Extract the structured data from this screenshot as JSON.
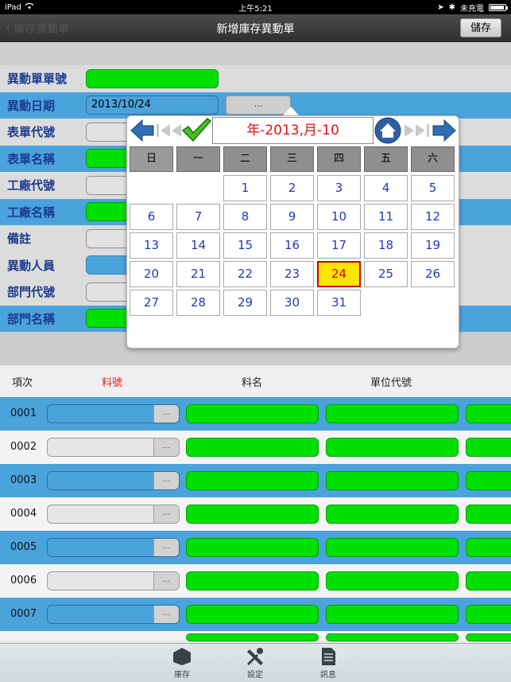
{
  "status": {
    "device": "iPad",
    "time": "上午5:21",
    "charge": "未充電"
  },
  "nav": {
    "back_label": "庫存異動單",
    "title": "新增庫存異動單",
    "save_label": "儲存"
  },
  "form": {
    "rows": [
      {
        "label": "異動單單號",
        "value": ""
      },
      {
        "label": "異動日期",
        "value": "2013/10/24",
        "button": "..."
      },
      {
        "label": "表單代號",
        "value": ""
      },
      {
        "label": "表單名稱",
        "value": ""
      },
      {
        "label": "工廠代號",
        "value": ""
      },
      {
        "label": "工廠名稱",
        "value": ""
      },
      {
        "label": "備註",
        "value": ""
      },
      {
        "label": "異動人員",
        "value": ""
      },
      {
        "label": "部門代號",
        "value": ""
      },
      {
        "label": "部門名稱",
        "value": ""
      }
    ]
  },
  "table": {
    "headers": {
      "item": "項次",
      "part_no": "料號",
      "part_name": "料名",
      "unit_code": "單位代號"
    },
    "rows": [
      {
        "num": "0001",
        "button": "..."
      },
      {
        "num": "0002",
        "button": "..."
      },
      {
        "num": "0003",
        "button": "..."
      },
      {
        "num": "0004",
        "button": "..."
      },
      {
        "num": "0005",
        "button": "..."
      },
      {
        "num": "0006",
        "button": "..."
      },
      {
        "num": "0007",
        "button": "..."
      }
    ]
  },
  "calendar": {
    "title": "年-2013,月-10",
    "weekdays": [
      "日",
      "一",
      "二",
      "三",
      "四",
      "五",
      "六"
    ],
    "days": [
      "1",
      "2",
      "3",
      "4",
      "5",
      "6",
      "7",
      "8",
      "9",
      "10",
      "11",
      "12",
      "13",
      "14",
      "15",
      "16",
      "17",
      "18",
      "19",
      "20",
      "21",
      "22",
      "23",
      "24",
      "25",
      "26",
      "27",
      "28",
      "29",
      "30",
      "31"
    ],
    "selected_day": "24",
    "colors": {
      "title": "#d11111",
      "day_text": "#1f3bb5",
      "selected_bg": "#ffe600",
      "selected_border": "#d10000"
    }
  },
  "tabbar": {
    "items": [
      {
        "label": "庫存",
        "icon": "cube-icon"
      },
      {
        "label": "設定",
        "icon": "tools-icon"
      },
      {
        "label": "訊息",
        "icon": "document-icon"
      }
    ]
  },
  "colors": {
    "row_blue": "#4ba3dc",
    "field_green": "#00e000",
    "label_blue": "#1b3a8f",
    "header_red": "#e02020"
  }
}
